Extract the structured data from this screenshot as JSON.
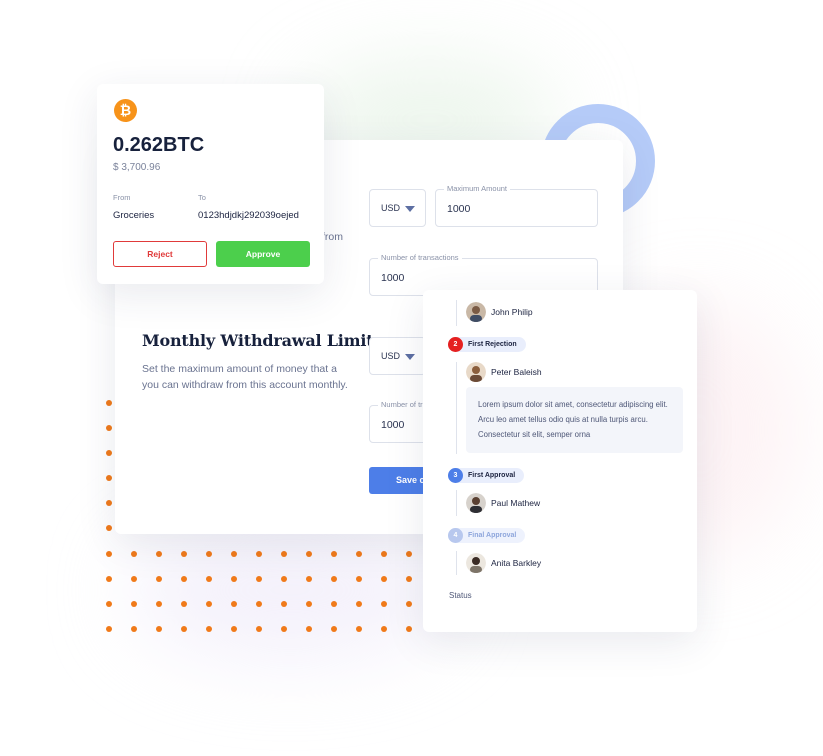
{
  "bitcoin": {
    "icon": "bitcoin-icon",
    "icon_glyph": "₿",
    "amount": "0.262BTC",
    "usd_value": "$ 3,700.96",
    "from_label": "From",
    "from_value": "Groceries",
    "to_label": "To",
    "to_value": "0123hdjdkj292039oejed",
    "reject_label": "Reject",
    "approve_label": "Approve"
  },
  "limit_form": {
    "hidden_text": "from",
    "title": "Monthly Withdrawal Limit",
    "description": "Set the maximum amount of money that a you can withdraw from this account monthly.",
    "currency_1": "USD",
    "max_amount_label": "Maximum Amount",
    "max_amount_value": "1000",
    "transactions_label": "Number of transactions",
    "transactions_value": "1000",
    "currency_2": "USD",
    "transactions_label_2": "Number of tr",
    "transactions_value_2": "1000",
    "save_label": "Save c"
  },
  "approvals": {
    "steps": [
      {
        "number": "2",
        "label": "First Rejection"
      },
      {
        "number": "3",
        "label": "First Approval"
      },
      {
        "number": "4",
        "label": "Final Approval"
      }
    ],
    "people": [
      "John Philip",
      "Peter Baleish",
      "Paul Mathew",
      "Anita Barkley"
    ],
    "comment": "Lorem ipsum dolor sit amet, consectetur adipiscing elit. Arcu leo amet tellus odio quis at nulla turpis arcu. Consectetur sit elit, semper orna",
    "status_label": "Status"
  },
  "colors": {
    "brand_blue": "#4d7ee8",
    "reject_red": "#e03a3a",
    "approve_green": "#4ccf4c",
    "bitcoin_orange": "#f7931a",
    "dot_orange": "#f07a1a"
  }
}
